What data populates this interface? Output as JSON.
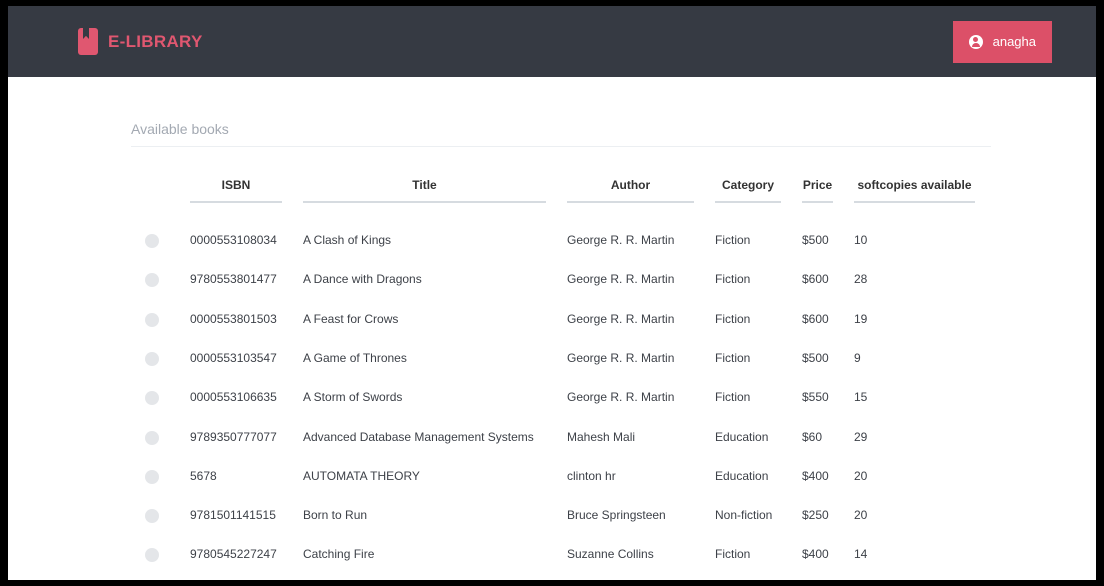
{
  "navbar": {
    "brand": "E-LIBRARY",
    "user_name": "anagha"
  },
  "section": {
    "title": "Available books"
  },
  "table": {
    "headers": [
      "ISBN",
      "Title",
      "Author",
      "Category",
      "Price",
      "softcopies available"
    ],
    "rows": [
      [
        "0000553108034",
        "A Clash of Kings",
        "George R. R. Martin",
        "Fiction",
        "$500",
        "10"
      ],
      [
        "9780553801477",
        "A Dance with Dragons",
        "George R. R. Martin",
        "Fiction",
        "$600",
        "28"
      ],
      [
        "0000553801503",
        "A Feast for Crows",
        "George R. R. Martin",
        "Fiction",
        "$600",
        "19"
      ],
      [
        "0000553103547",
        "A Game of Thrones",
        "George R. R. Martin",
        "Fiction",
        "$500",
        "9"
      ],
      [
        "0000553106635",
        "A Storm of Swords",
        "George R. R. Martin",
        "Fiction",
        "$550",
        "15"
      ],
      [
        "9789350777077",
        "Advanced Database Management Systems",
        "Mahesh Mali",
        "Education",
        "$60",
        "29"
      ],
      [
        "5678",
        "AUTOMATA THEORY",
        "clinton hr",
        "Education",
        "$400",
        "20"
      ],
      [
        "9781501141515",
        "Born to Run",
        "Bruce Springsteen",
        "Non-fiction",
        "$250",
        "20"
      ],
      [
        "9780545227247",
        "Catching Fire",
        "Suzanne Collins",
        "Fiction",
        "$400",
        "14"
      ]
    ]
  },
  "colors": {
    "navbar_bg": "#363a43",
    "accent": "#e05770",
    "user_button_bg": "#dc5068"
  },
  "icons": {
    "brand": "bookmark-book-icon",
    "user": "user-circle-icon"
  }
}
